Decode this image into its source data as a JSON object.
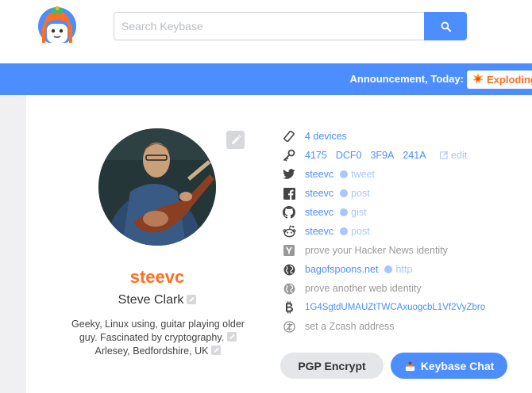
{
  "search": {
    "placeholder": "Search Keybase"
  },
  "announcement": {
    "label": "Announcement, Today:",
    "chip": "Exploding"
  },
  "profile": {
    "username": "steevc",
    "full_name": "Steve Clark",
    "bio": "Geeky, Linux using, guitar playing older guy. Fascinated by cryptography.",
    "location": "Arlesey, Bedfordshire, UK"
  },
  "proofs": {
    "devices": "4 devices",
    "fingerprint": [
      "4175",
      "DCF0",
      "3F9A",
      "241A"
    ],
    "fingerprint_edit": "edit",
    "twitter": {
      "name": "steevc",
      "kind": "tweet"
    },
    "facebook": {
      "name": "steevc",
      "kind": "post"
    },
    "github": {
      "name": "steevc",
      "kind": "gist"
    },
    "reddit": {
      "name": "steevc",
      "kind": "post"
    },
    "hackernews_prompt": "prove your Hacker News identity",
    "website": {
      "name": "bagofspoons.net",
      "kind": "http"
    },
    "web_prompt": "prove another web identity",
    "bitcoin": "1G4SgtdUMAUZtTWCAxuogcbL1Vf2VyZbro",
    "zcash_prompt": "set a Zcash address"
  },
  "buttons": {
    "pgp": "PGP Encrypt",
    "chat": "Keybase Chat"
  },
  "colors": {
    "accent": "#4c8eff",
    "username": "#ff6f21",
    "proof_dot": "#a8c6ff"
  }
}
